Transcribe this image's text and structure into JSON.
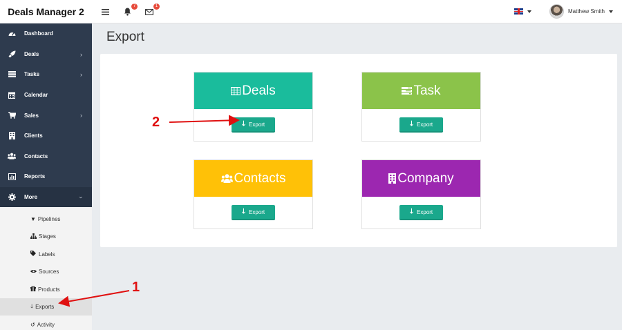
{
  "app": {
    "title": "Deals Manager 2"
  },
  "topbar": {
    "notifications_count": "7",
    "messages_count": "1",
    "user_name": "Matthew Smith"
  },
  "sidebar": {
    "items": [
      {
        "label": "Dashboard",
        "icon": "dashboard-icon",
        "has_submenu": false
      },
      {
        "label": "Deals",
        "icon": "rocket-icon",
        "has_submenu": true
      },
      {
        "label": "Tasks",
        "icon": "tasks-icon",
        "has_submenu": true
      },
      {
        "label": "Calendar",
        "icon": "calendar-icon",
        "has_submenu": false
      },
      {
        "label": "Sales",
        "icon": "cart-icon",
        "has_submenu": true
      },
      {
        "label": "Clients",
        "icon": "building-icon",
        "has_submenu": false
      },
      {
        "label": "Contacts",
        "icon": "users-icon",
        "has_submenu": false
      },
      {
        "label": "Reports",
        "icon": "chart-icon",
        "has_submenu": false
      },
      {
        "label": "More",
        "icon": "gear-icon",
        "has_submenu": true
      }
    ],
    "more_items": [
      {
        "label": "Pipelines",
        "icon": "filter-icon"
      },
      {
        "label": "Stages",
        "icon": "sitemap-icon"
      },
      {
        "label": "Labels",
        "icon": "tags-icon"
      },
      {
        "label": "Sources",
        "icon": "eye-icon"
      },
      {
        "label": "Products",
        "icon": "gift-icon"
      },
      {
        "label": "Exports",
        "icon": "arrow-down-icon"
      },
      {
        "label": "Activity",
        "icon": "history-icon"
      }
    ]
  },
  "page": {
    "title": "Export"
  },
  "cards": [
    {
      "title": "Deals",
      "color": "#1abc9c",
      "icon": "table-icon",
      "button": "Export"
    },
    {
      "title": "Task",
      "color": "#8bc34a",
      "icon": "tasks-icon",
      "button": "Export"
    },
    {
      "title": "Contacts",
      "color": "#ffc107",
      "icon": "users-icon",
      "button": "Export"
    },
    {
      "title": "Company",
      "color": "#9c27b0",
      "icon": "building-icon",
      "button": "Export"
    }
  ],
  "annotations": {
    "one": "1",
    "two": "2",
    "color": "#e01010"
  }
}
